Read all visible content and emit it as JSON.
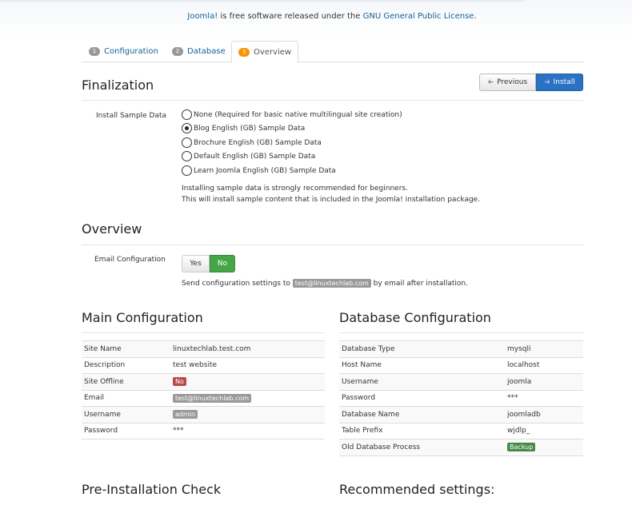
{
  "header": {
    "license_link1": "Joomla!",
    "license_mid": " is free software released under the ",
    "license_link2": "GNU General Public License",
    "license_end": "."
  },
  "tabs": [
    {
      "num": "1",
      "label": "Configuration"
    },
    {
      "num": "2",
      "label": "Database"
    },
    {
      "num": "3",
      "label": "Overview"
    }
  ],
  "finalization": {
    "title": "Finalization",
    "prev_label": "Previous",
    "install_label": "Install",
    "sample_label": "Install Sample Data",
    "options": [
      "None (Required for basic native multilingual site creation)",
      "Blog English (GB) Sample Data",
      "Brochure English (GB) Sample Data",
      "Default English (GB) Sample Data",
      "Learn Joomla English (GB) Sample Data"
    ],
    "selected_index": 1,
    "note_line1": "Installing sample data is strongly recommended for beginners.",
    "note_line2": "This will install sample content that is included in the Joomla! installation package."
  },
  "overview": {
    "title": "Overview",
    "email_label": "Email Configuration",
    "yes": "Yes",
    "no": "No",
    "send_pre": "Send configuration settings to",
    "send_email": "test@linuxtechlab.com",
    "send_post": "by email after installation."
  },
  "main_config": {
    "title": "Main Configuration",
    "rows": [
      {
        "k": "Site Name",
        "v": "linuxtechlab.test.com"
      },
      {
        "k": "Description",
        "v": "test website"
      },
      {
        "k": "Site Offline",
        "v": "No"
      },
      {
        "k": "Email",
        "v": "test@linuxtechlab.com"
      },
      {
        "k": "Username",
        "v": "admin"
      },
      {
        "k": "Password",
        "v": "***"
      }
    ]
  },
  "db_config": {
    "title": "Database Configuration",
    "rows": [
      {
        "k": "Database Type",
        "v": "mysqli"
      },
      {
        "k": "Host Name",
        "v": "localhost"
      },
      {
        "k": "Username",
        "v": "joomla"
      },
      {
        "k": "Password",
        "v": "***"
      },
      {
        "k": "Database Name",
        "v": "joomladb"
      },
      {
        "k": "Table Prefix",
        "v": "wjdlp_"
      },
      {
        "k": "Old Database Process",
        "v": "Backup"
      }
    ]
  },
  "footer_sections": {
    "pre_install": "Pre-Installation Check",
    "recommended": "Recommended settings:"
  },
  "colors": {
    "link": "#146295",
    "install_btn": "#2a73c4",
    "toggle_no": "#46a546",
    "badge_red": "#b94a48",
    "badge_green": "#468847",
    "tab_active_badge": "#f89406"
  }
}
